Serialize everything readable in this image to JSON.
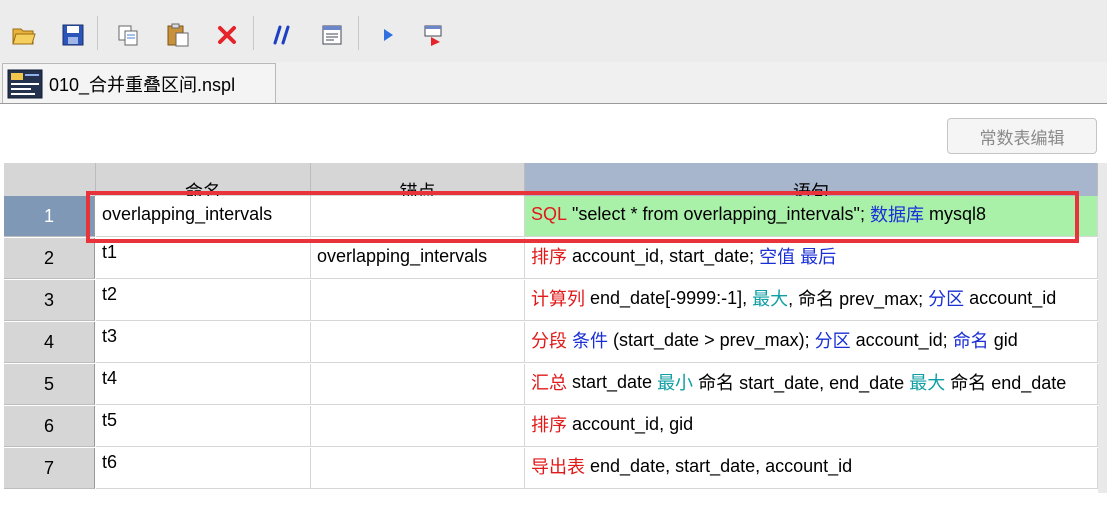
{
  "toolbar": {
    "buttons": [
      {
        "name": "open-icon"
      },
      {
        "name": "save-icon"
      },
      {
        "name": "copy-icon"
      },
      {
        "name": "paste-icon"
      },
      {
        "name": "delete-icon"
      },
      {
        "name": "comment-icon"
      },
      {
        "name": "text-editor-icon"
      },
      {
        "name": "run-icon"
      },
      {
        "name": "step-run-icon"
      }
    ]
  },
  "file_tab": {
    "label": "010_合并重叠区间.nspl"
  },
  "const_button": "常数表编辑",
  "grid": {
    "headers": {
      "name": "命名",
      "anchor": "锚点",
      "statement": "语句"
    },
    "rows": [
      {
        "num": "1",
        "name": "overlapping_intervals",
        "anchor": "",
        "stmt": [
          {
            "t": "SQL",
            "c": "red"
          },
          {
            "t": " \"select * from overlapping_intervals\"; ",
            "c": ""
          },
          {
            "t": "数据库",
            "c": "blue"
          },
          {
            "t": " mysql8",
            "c": ""
          }
        ]
      },
      {
        "num": "2",
        "name": "t1",
        "anchor": "overlapping_intervals",
        "stmt": [
          {
            "t": "排序",
            "c": "red"
          },
          {
            "t": " account_id, start_date; ",
            "c": ""
          },
          {
            "t": "空值 最后",
            "c": "blue"
          }
        ]
      },
      {
        "num": "3",
        "name": "t2",
        "anchor": "",
        "stmt": [
          {
            "t": "计算列",
            "c": "red"
          },
          {
            "t": " end_date[-9999:-1], ",
            "c": ""
          },
          {
            "t": "最大",
            "c": "teal"
          },
          {
            "t": ", 命名 prev_max; ",
            "c": ""
          },
          {
            "t": "分区",
            "c": "blue"
          },
          {
            "t": " account_id",
            "c": ""
          }
        ]
      },
      {
        "num": "4",
        "name": "t3",
        "anchor": "",
        "stmt": [
          {
            "t": "分段",
            "c": "red"
          },
          {
            "t": " ",
            "c": ""
          },
          {
            "t": "条件",
            "c": "blue"
          },
          {
            "t": " (start_date > prev_max); ",
            "c": ""
          },
          {
            "t": "分区",
            "c": "blue"
          },
          {
            "t": " account_id; ",
            "c": ""
          },
          {
            "t": "命名",
            "c": "blue"
          },
          {
            "t": " gid",
            "c": ""
          }
        ]
      },
      {
        "num": "5",
        "name": "t4",
        "anchor": "",
        "stmt": [
          {
            "t": "汇总",
            "c": "red"
          },
          {
            "t": " start_date ",
            "c": ""
          },
          {
            "t": "最小",
            "c": "teal"
          },
          {
            "t": " 命名 start_date, end_date ",
            "c": ""
          },
          {
            "t": "最大",
            "c": "teal"
          },
          {
            "t": " 命名 end_date",
            "c": ""
          }
        ]
      },
      {
        "num": "6",
        "name": "t5",
        "anchor": "",
        "stmt": [
          {
            "t": "排序",
            "c": "red"
          },
          {
            "t": " account_id, gid",
            "c": ""
          }
        ]
      },
      {
        "num": "7",
        "name": "t6",
        "anchor": "",
        "stmt": [
          {
            "t": "导出表",
            "c": "red"
          },
          {
            "t": " end_date, start_date, account_id",
            "c": ""
          }
        ]
      }
    ]
  },
  "colors": {
    "keyword_red": "#e01a1a",
    "keyword_blue": "#1a2fd6",
    "keyword_teal": "#0f9ea3",
    "selected_row": "#7f98b6",
    "sql_highlight": "#a9f0a9",
    "callout_border": "#e8333b"
  }
}
